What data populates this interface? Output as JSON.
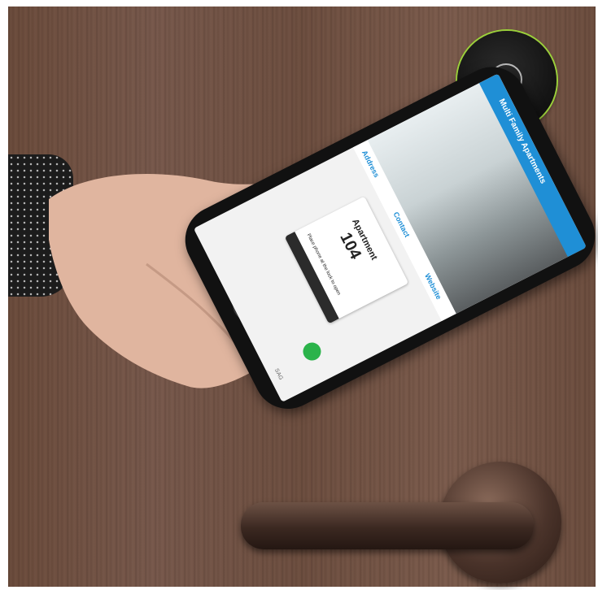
{
  "photo": {
    "scene": "hand-holding-phone-at-door-reader",
    "colors": {
      "door": "#6f4f41",
      "reader_glow": "#9ad03a",
      "app_blue": "#1f8fd6",
      "nfc_green": "#2bb34a"
    }
  },
  "phone_screen": {
    "header_title": "Multi Family Apartments",
    "tabs": [
      "Address",
      "Contact",
      "Website"
    ],
    "key_card": {
      "label": "Apartment",
      "number": "104",
      "instruction": "Place phone at the lock to open",
      "brand": "SAG"
    }
  }
}
